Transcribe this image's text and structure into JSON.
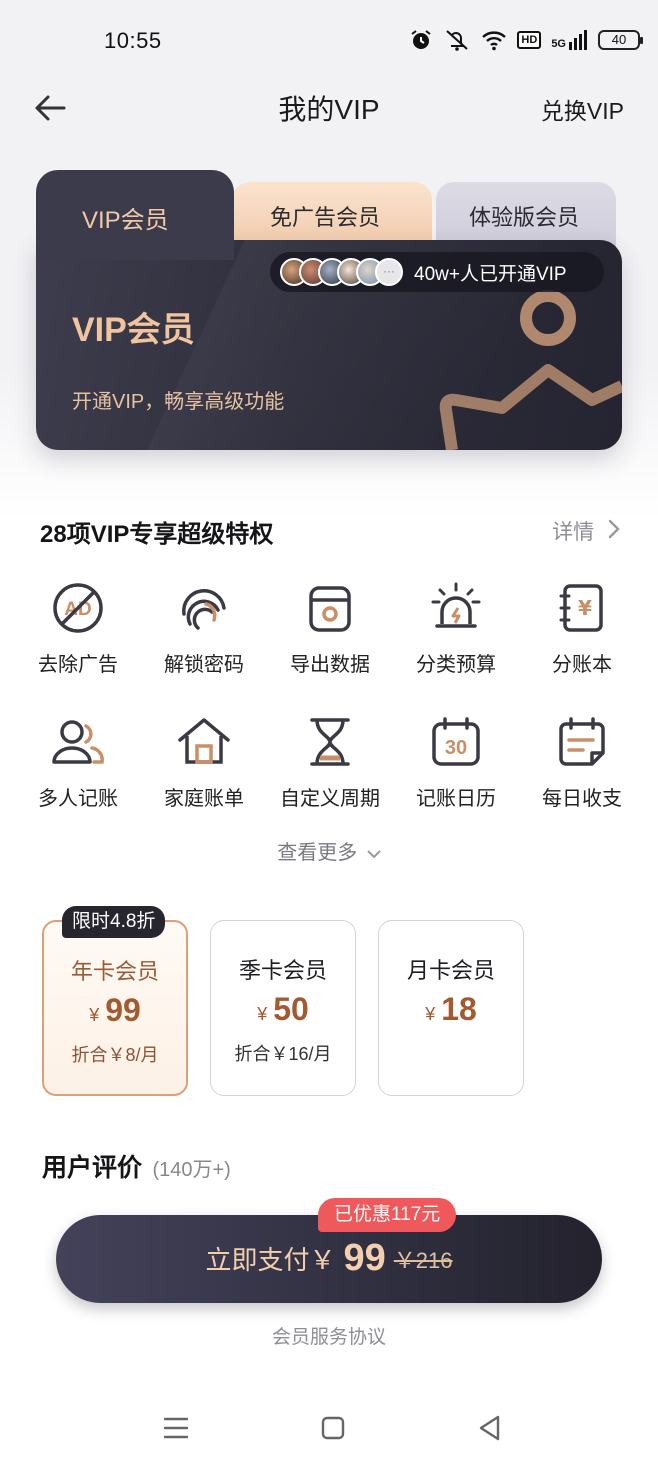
{
  "status_bar": {
    "time": "10:55",
    "battery": "40",
    "hd": "HD",
    "network": "5G"
  },
  "header": {
    "title": "我的VIP",
    "redeem": "兑换VIP"
  },
  "card": {
    "tabs": [
      "VIP会员",
      "免广告会员",
      "体验版会员"
    ],
    "active_tab": 0,
    "title": "VIP会员",
    "subtitle": "开通VIP，畅享高级功能",
    "members_text": "40w+人已开通VIP",
    "accent": "#f0c4a0"
  },
  "privileges": {
    "title": "28项VIP专享超级特权",
    "detail": "详情",
    "items": [
      {
        "label": "去除广告",
        "icon": "no-ads-icon"
      },
      {
        "label": "解锁密码",
        "icon": "fingerprint-icon"
      },
      {
        "label": "导出数据",
        "icon": "export-data-icon"
      },
      {
        "label": "分类预算",
        "icon": "budget-alarm-icon"
      },
      {
        "label": "分账本",
        "icon": "ledger-book-icon"
      },
      {
        "label": "多人记账",
        "icon": "multi-user-icon"
      },
      {
        "label": "家庭账单",
        "icon": "home-icon"
      },
      {
        "label": "自定义周期",
        "icon": "hourglass-icon"
      },
      {
        "label": "记账日历",
        "icon": "calendar-icon"
      },
      {
        "label": "每日收支",
        "icon": "daily-note-icon"
      }
    ],
    "see_more": "查看更多"
  },
  "plans": [
    {
      "name": "年卡会员",
      "currency": "¥",
      "price": "99",
      "note": "折合￥8/月",
      "badge": "限时4.8折",
      "selected": true
    },
    {
      "name": "季卡会员",
      "currency": "¥",
      "price": "50",
      "note": "折合￥16/月",
      "badge": "",
      "selected": false
    },
    {
      "name": "月卡会员",
      "currency": "¥",
      "price": "18",
      "note": "",
      "badge": "",
      "selected": false
    }
  ],
  "reviews": {
    "title": "用户评价",
    "count": "(140万+)"
  },
  "pay": {
    "label": "立即支付￥",
    "price": "99",
    "original": "￥216",
    "discount": "已优惠117元",
    "agreement": "会员服务协议"
  },
  "colors": {
    "brand_gold": "#a25a30",
    "dark": "#2f2e3c",
    "discount_red": "#f0595b"
  }
}
